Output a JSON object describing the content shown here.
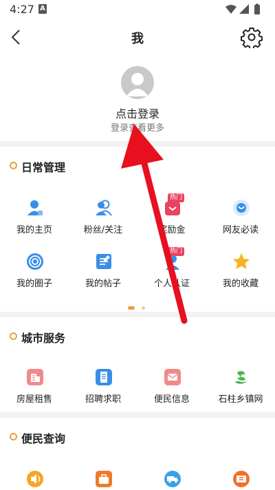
{
  "status": {
    "time": "4:27",
    "notification_letter": "A"
  },
  "nav": {
    "title": "我"
  },
  "profile": {
    "login": "点击登录",
    "sub": "登录查看更多"
  },
  "daily": {
    "title": "日常管理",
    "items": [
      {
        "label": "我的主页",
        "icon": "user-icon"
      },
      {
        "label": "粉丝/关注",
        "icon": "followers-icon"
      },
      {
        "label": "奖励金",
        "icon": "reward-icon",
        "badge": "热门"
      },
      {
        "label": "网友必读",
        "icon": "must-read-icon"
      },
      {
        "label": "我的圈子",
        "icon": "circle-icon"
      },
      {
        "label": "我的帖子",
        "icon": "post-icon"
      },
      {
        "label": "个人认证",
        "icon": "verify-icon",
        "badge": "热门"
      },
      {
        "label": "我的收藏",
        "icon": "star-icon"
      }
    ],
    "pages": 2,
    "current_page": 1
  },
  "city": {
    "title": "城市服务",
    "items": [
      {
        "label": "房屋租售",
        "icon": "house-icon"
      },
      {
        "label": "招聘求职",
        "icon": "job-icon"
      },
      {
        "label": "便民信息",
        "icon": "info-icon"
      },
      {
        "label": "石柱乡镇网",
        "icon": "town-logo-icon"
      }
    ]
  },
  "query": {
    "title": "便民查询",
    "items": [
      {
        "icon": "speaker-icon"
      },
      {
        "icon": "tool-icon"
      },
      {
        "icon": "truck-icon"
      },
      {
        "icon": "ticket-icon"
      }
    ]
  },
  "colors": {
    "accent": "#f39c3d",
    "hot": "#e84460",
    "annotation_arrow": "#e8101e"
  }
}
